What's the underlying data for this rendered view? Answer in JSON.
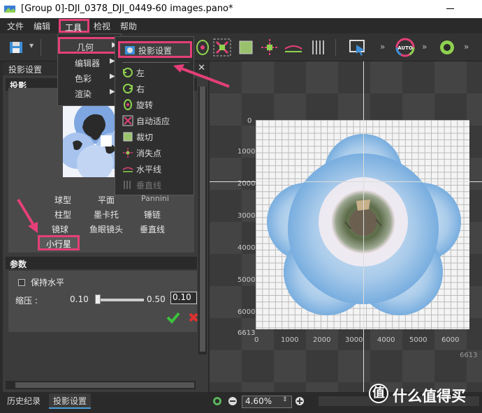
{
  "window": {
    "title": "[Group 0]-DJI_0378_DJI_0449-60 images.pano*"
  },
  "menubar": {
    "items": [
      "文件",
      "编辑",
      "工具",
      "检视",
      "帮助"
    ]
  },
  "tools_menu": {
    "items": [
      {
        "label": "几何",
        "has_submenu": true
      },
      {
        "label": "编辑器",
        "has_submenu": true
      },
      {
        "label": "色彩",
        "has_submenu": true
      },
      {
        "label": "渲染",
        "has_submenu": true
      }
    ]
  },
  "geometry_menu": {
    "items": [
      {
        "label": "投影设置",
        "icon": "projection-icon",
        "enabled": true
      },
      {
        "label": "左",
        "icon": "rotate-left-icon",
        "enabled": true
      },
      {
        "label": "右",
        "icon": "rotate-right-icon",
        "enabled": true
      },
      {
        "label": "旋转",
        "icon": "rotate-icon",
        "enabled": true
      },
      {
        "label": "自动适应",
        "icon": "auto-fit-icon",
        "enabled": true
      },
      {
        "label": "裁切",
        "icon": "crop-icon",
        "enabled": true
      },
      {
        "label": "消失点",
        "icon": "vanishing-point-icon",
        "enabled": true
      },
      {
        "label": "水平线",
        "icon": "horizon-icon",
        "enabled": true
      },
      {
        "label": "垂直线",
        "icon": "vertical-line-icon",
        "enabled": false
      }
    ]
  },
  "toolbar": {
    "auto_label": "AUTO"
  },
  "panel": {
    "title": "投影设置",
    "projection_section": "投影",
    "projection_options": [
      [
        "球型",
        "平面",
        "Pannini"
      ],
      [
        "柱型",
        "墨卡托",
        "锤链"
      ],
      [
        "镜球",
        "鱼眼镜头",
        "垂直线"
      ]
    ],
    "little_planet": "小行星",
    "params_section": "参数",
    "keep_level": "保持水平",
    "compress_label": "缩压 :",
    "compress_min": "0.10",
    "compress_max": "0.50",
    "compress_value": "0.10"
  },
  "bottom_tabs": {
    "history": "历史纪录",
    "projection": "投影设置"
  },
  "preview": {
    "x_ticks": [
      "0",
      "1000",
      "2000",
      "3000",
      "4000",
      "5000",
      "6000"
    ],
    "y_ticks": [
      "0",
      "1000",
      "2000",
      "3000",
      "4000",
      "5000",
      "6000",
      "6613"
    ],
    "corner": "6613"
  },
  "zoombar": {
    "zoom": "4.60%"
  },
  "watermark": {
    "text": "什么值得买",
    "icon": "值"
  },
  "colors": {
    "highlight": "#e43f79",
    "accent": "#4a9fd8"
  }
}
